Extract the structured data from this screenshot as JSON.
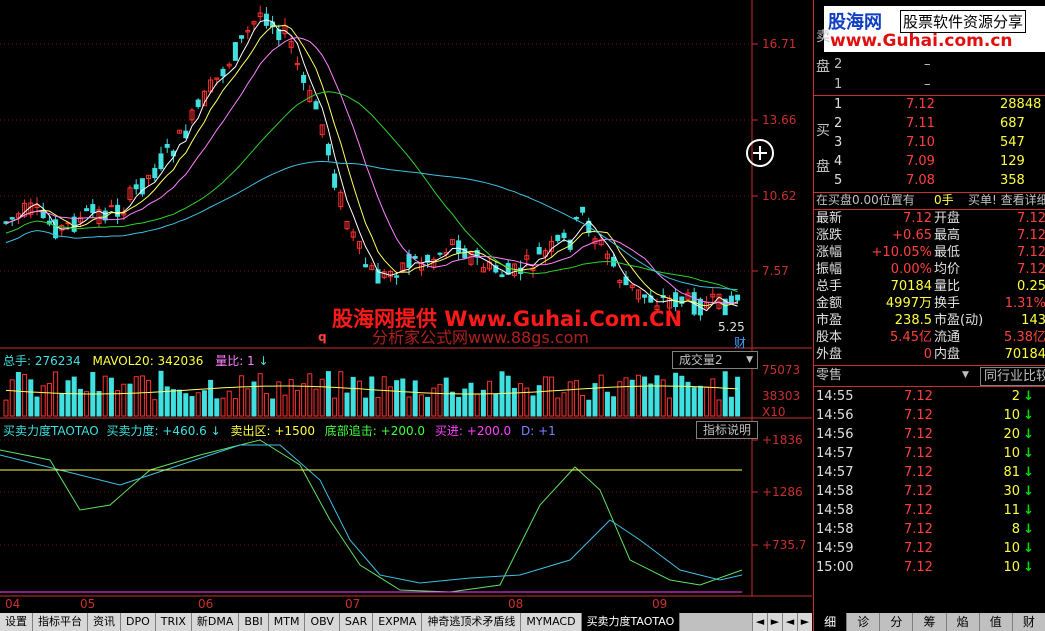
{
  "price_axis": [
    "16.71",
    "13.66",
    "10.62",
    "7.57"
  ],
  "low_marker": "5.25",
  "cai_label": "财",
  "q_marker": "q",
  "watermark1": "股海网提供 Www.Guhai.Com.CN",
  "watermark2": "分析家公式网www.88gs.com",
  "volume_bar": {
    "total": "总手: 276234",
    "mavol": "MAVOL20: 342036",
    "ratio": "量比: 1",
    "arrow": "↓",
    "dropdown": "成交量2",
    "dropdown_arrow": "▼"
  },
  "volume_axis": [
    "75073",
    "38303",
    "X10"
  ],
  "indicator_bar": {
    "name": "买卖力度TAOTAO",
    "force": "买卖力度: +460.6",
    "arrow": "↓",
    "sell": "卖出区: +1500",
    "bottom": "底部追击: +200.0",
    "buy": "买进: +200.0",
    "d": "D: +1",
    "help": "指标说明"
  },
  "indicator_axis": [
    "+1836",
    "+1286",
    "+735.7"
  ],
  "date_axis": [
    "04",
    "05",
    "06",
    "07",
    "08",
    "09"
  ],
  "tabs": [
    "设置",
    "指标平台",
    "资讯",
    "DPO",
    "TRIX",
    "新DMA",
    "BBI",
    "MTM",
    "OBV",
    "SAR",
    "EXPMA",
    "神奇逃顶术矛盾线",
    "MYMACD",
    "买卖力度TAOTAO"
  ],
  "tab_arrows": [
    "◄",
    "►",
    "◄",
    "►"
  ],
  "logo": {
    "brand": "股海网",
    "slogan": "股票软件资源分享",
    "url": "www.Guhai.com.cn"
  },
  "sell_side": {
    "label1": "卖",
    "label2": "盘",
    "rows": [
      {
        "n": "2",
        "p": "–"
      },
      {
        "n": "1",
        "p": "–"
      }
    ]
  },
  "buy_side": {
    "label1": "买",
    "label2": "盘",
    "rows": [
      {
        "n": "1",
        "p": "7.12",
        "v": "28848"
      },
      {
        "n": "2",
        "p": "7.11",
        "v": "687"
      },
      {
        "n": "3",
        "p": "7.10",
        "v": "547"
      },
      {
        "n": "4",
        "p": "7.09",
        "v": "129"
      },
      {
        "n": "5",
        "p": "7.08",
        "v": "358"
      }
    ]
  },
  "info_line": {
    "left": "在买盘0.00位置有",
    "mid": "0手",
    "right": "买单! 查看详细"
  },
  "quotes": [
    {
      "l": "最新",
      "lv": "7.12",
      "r": "开盘",
      "rv": "7.12"
    },
    {
      "l": "涨跌",
      "lv": "+0.65",
      "r": "最高",
      "rv": "7.12"
    },
    {
      "l": "涨幅",
      "lv": "+10.05%",
      "r": "最低",
      "rv": "7.12"
    },
    {
      "l": "振幅",
      "lv": "0.00%",
      "r": "均价",
      "rv": "7.12"
    },
    {
      "l": "总手",
      "lv": "70184",
      "r": "量比",
      "rv": "0.25"
    },
    {
      "l": "金额",
      "lv": "4997万",
      "r": "换手",
      "rv": "1.31%"
    },
    {
      "l": "市盈",
      "lv": "238.5",
      "r": "市盈(动)",
      "rv": "143"
    },
    {
      "l": "股本",
      "lv": "5.45亿",
      "r": "流通",
      "rv": "5.38亿"
    },
    {
      "l": "外盘",
      "lv": "0",
      "r": "内盘",
      "rv": "70184"
    }
  ],
  "ticks_header": {
    "left": "零售",
    "mid": "▼",
    "right": "同行业比较"
  },
  "ticks": [
    {
      "t": "14:55",
      "p": "7.12",
      "v": "2"
    },
    {
      "t": "14:56",
      "p": "7.12",
      "v": "10"
    },
    {
      "t": "14:56",
      "p": "7.12",
      "v": "20"
    },
    {
      "t": "14:57",
      "p": "7.12",
      "v": "10"
    },
    {
      "t": "14:57",
      "p": "7.12",
      "v": "81"
    },
    {
      "t": "14:58",
      "p": "7.12",
      "v": "30"
    },
    {
      "t": "14:58",
      "p": "7.12",
      "v": "11"
    },
    {
      "t": "14:58",
      "p": "7.12",
      "v": "8"
    },
    {
      "t": "14:59",
      "p": "7.12",
      "v": "10"
    },
    {
      "t": "15:00",
      "p": "7.12",
      "v": "10"
    }
  ],
  "tick_arrow": "↓",
  "right_tabs": [
    "细",
    "诊",
    "分",
    "筹",
    "焰",
    "值",
    "财"
  ],
  "colors": {
    "up": "#ff3030",
    "down": "#40e0e0",
    "ma5": "#ffffff",
    "ma10": "#ffff60",
    "ma20": "#ff80ff",
    "ma60": "#30d030",
    "ma120": "#40c0e0",
    "border": "#c83030"
  }
}
